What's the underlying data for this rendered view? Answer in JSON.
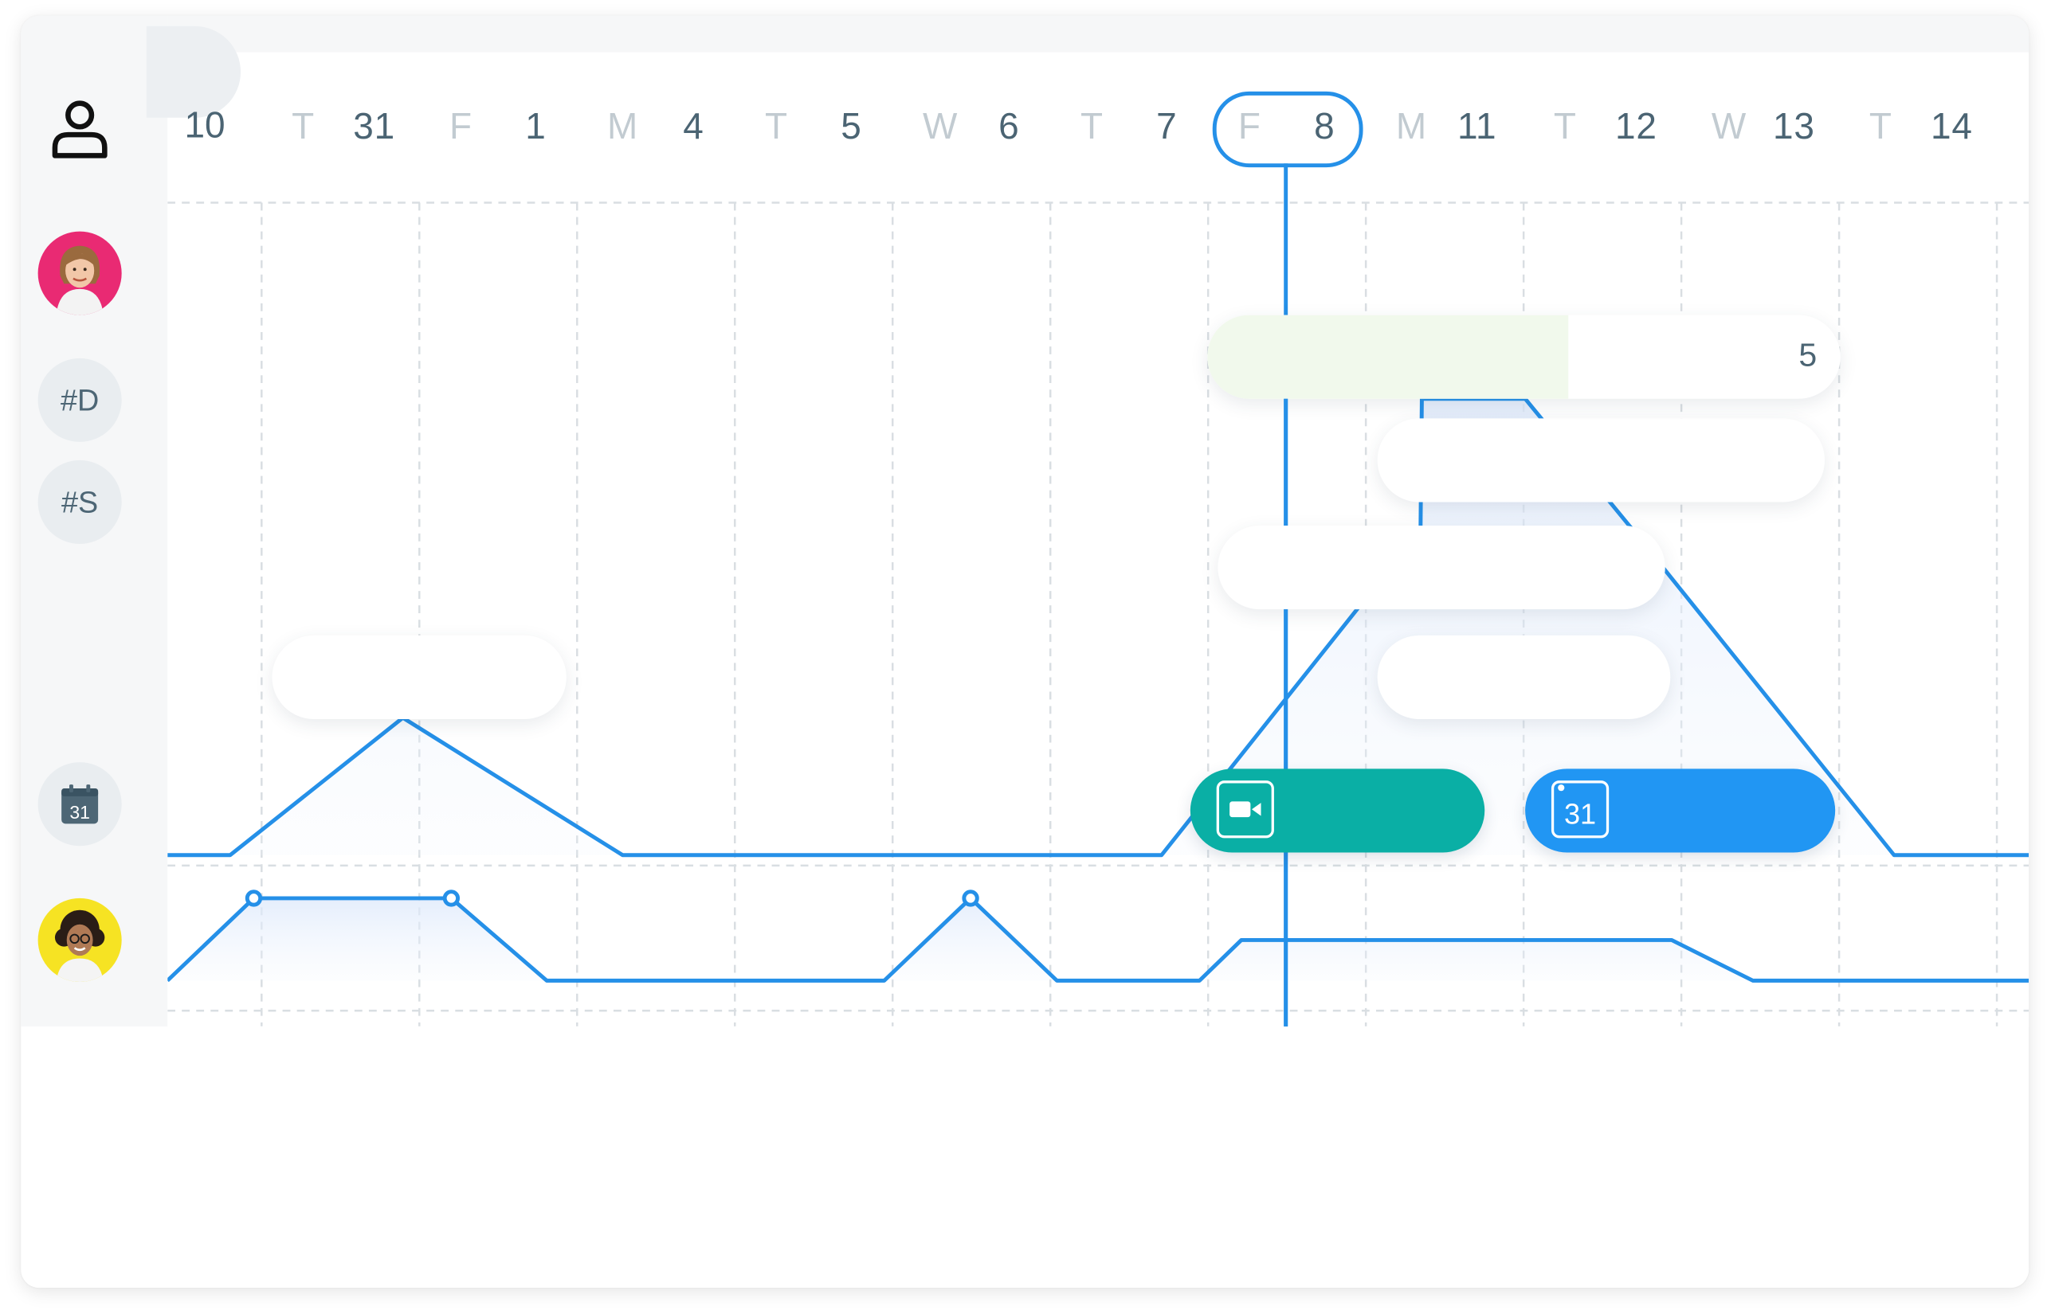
{
  "colors": {
    "accent_blue": "#2590e8",
    "teal": "#0aafa5",
    "event_blue": "#2196f3",
    "progress_fill": "#f1f9ec",
    "text_dark": "#4b6473",
    "text_light": "#c2cbd1"
  },
  "sidebar": {
    "user_icon": "person-outline-icon",
    "tags": [
      {
        "label": "#D"
      },
      {
        "label": "#S"
      }
    ],
    "calendar_icon_label": "31"
  },
  "timeline": {
    "year_label": "10",
    "days": [
      {
        "dow": "T",
        "num": "31"
      },
      {
        "dow": "F",
        "num": "1"
      },
      {
        "dow": "M",
        "num": "4"
      },
      {
        "dow": "T",
        "num": "5"
      },
      {
        "dow": "W",
        "num": "6"
      },
      {
        "dow": "T",
        "num": "7"
      },
      {
        "dow": "F",
        "num": "8"
      },
      {
        "dow": "M",
        "num": "11"
      },
      {
        "dow": "T",
        "num": "12"
      },
      {
        "dow": "W",
        "num": "13"
      },
      {
        "dow": "T",
        "num": "14"
      }
    ],
    "today_index": 6
  },
  "tasks": {
    "progress_value": "5",
    "progress_fraction": 0.57
  },
  "events": {
    "video_icon": "video-camera-icon",
    "calendar_label": "31"
  }
}
